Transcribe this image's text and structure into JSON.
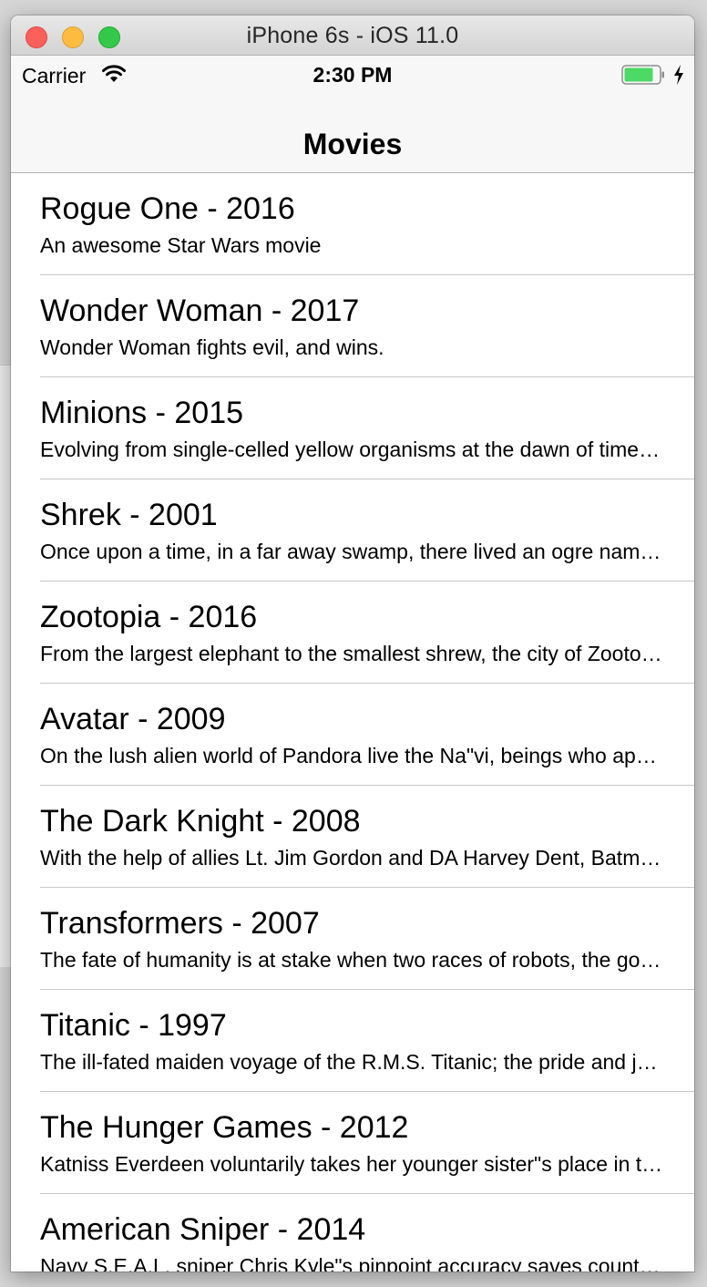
{
  "window": {
    "title": "iPhone 6s - iOS 11.0"
  },
  "statusbar": {
    "carrier": "Carrier",
    "time": "2:30 PM"
  },
  "navbar": {
    "title": "Movies"
  },
  "movies": [
    {
      "title": "Rogue One - 2016",
      "subtitle": "An awesome Star Wars movie"
    },
    {
      "title": "Wonder Woman - 2017",
      "subtitle": "Wonder Woman fights evil, and wins."
    },
    {
      "title": "Minions - 2015",
      "subtitle": "Evolving from single-celled yellow organisms at the dawn of time, Minions live to serve"
    },
    {
      "title": "Shrek - 2001",
      "subtitle": "Once upon a time, in a far away swamp, there lived an ogre named Shrek"
    },
    {
      "title": "Zootopia - 2016",
      "subtitle": "From the largest elephant to the smallest shrew, the city of Zootopia is a mammal metropolis"
    },
    {
      "title": "Avatar - 2009",
      "subtitle": "On the lush alien world of Pandora live the Na\"vi, beings who appear primitive"
    },
    {
      "title": "The Dark Knight - 2008",
      "subtitle": "With the help of allies Lt. Jim Gordon and DA Harvey Dent, Batman has been able to keep"
    },
    {
      "title": "Transformers - 2007",
      "subtitle": "The fate of humanity is at stake when two races of robots, the good Autobots"
    },
    {
      "title": "Titanic - 1997",
      "subtitle": "The ill-fated maiden voyage of the R.M.S. Titanic; the pride and joy of the White Star Line"
    },
    {
      "title": "The Hunger Games - 2012",
      "subtitle": "Katniss Everdeen voluntarily takes her younger sister\"s place in the Hunger Games"
    },
    {
      "title": "American Sniper - 2014",
      "subtitle": "Navy S.E.A.L. sniper Chris Kyle\"s pinpoint accuracy saves countless lives"
    }
  ],
  "colors": {
    "close": "#fc605b",
    "minimize": "#fdbc40",
    "maximize": "#34c84a",
    "battery": "#4cd964"
  },
  "icons": {
    "wifi": "wifi-icon",
    "battery": "battery-icon",
    "charging": "charging-bolt-icon"
  }
}
